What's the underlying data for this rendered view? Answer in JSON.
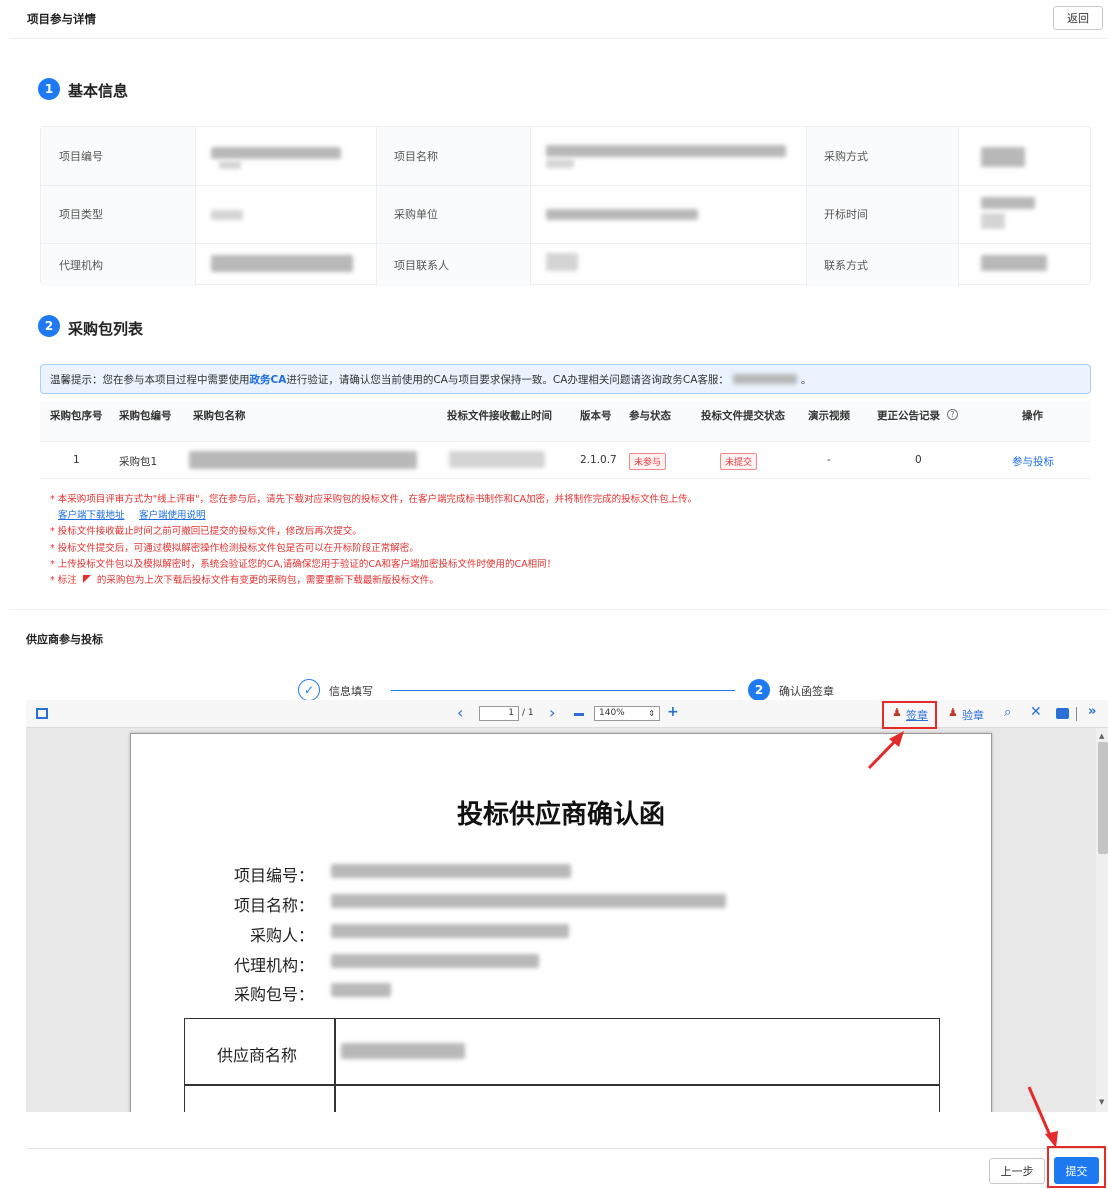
{
  "header": {
    "title": "项目参与详情",
    "back_label": "返回"
  },
  "section1": {
    "num": "1",
    "title": "基本信息"
  },
  "basic_info": {
    "project_no_label": "项目编号",
    "project_name_label": "项目名称",
    "purchase_method_label": "采购方式",
    "project_type_label": "项目类型",
    "purchase_unit_label": "采购单位",
    "open_time_label": "开标时间",
    "agency_label": "代理机构",
    "contact_label": "项目联系人",
    "contact_method_label": "联系方式"
  },
  "section2": {
    "num": "2",
    "title": "采购包列表"
  },
  "tip": {
    "prefix": "温馨提示：您在参与本项目过程中需要使用",
    "link": "政务CA",
    "suffix": "进行验证，请确认您当前使用的CA与项目要求保持一致。CA办理相关问题请咨询政务CA客服：",
    "end": "。"
  },
  "package_table": {
    "headers": [
      "采购包序号",
      "采购包编号",
      "采购包名称",
      "投标文件接收截止时间",
      "版本号",
      "参与状态",
      "投标文件提交状态",
      "演示视频",
      "更正公告记录",
      "操作"
    ],
    "help_icon": "question-circle-icon",
    "rows": [
      {
        "seq": "1",
        "code": "采购包1",
        "version": "2.1.0.7",
        "participate_status": "未参与",
        "submit_status": "未提交",
        "video": "-",
        "correction_count": "0",
        "action": "参与投标"
      }
    ]
  },
  "notes": {
    "n1": "* 本采购项目评审方式为\"线上评审\"，您在参与后，请先下载对应采购包的投标文件，在客户端完成标书制作和CA加密，并将制作完成的投标文件包上传。",
    "client_download": "客户端下载地址",
    "client_manual": "客户端使用说明",
    "n2": "* 投标文件接收截止时间之前可撤回已提交的投标文件，修改后再次提交。",
    "n3": "* 投标文件提交后，可通过模拟解密操作检测投标文件包是否可以在开标阶段正常解密。",
    "n4": "* 上传投标文件包以及模拟解密时，系统会验证您的CA,请确保您用于验证的CA和客户端加密投标文件时使用的CA相同！",
    "n5_prefix": "* 标注",
    "n5_suffix": "的采购包为上次下载后投标文件有变更的采购包，需要重新下载最新版投标文件。"
  },
  "supplier": {
    "title": "供应商参与投标",
    "step1_label": "信息填写",
    "step2_num": "2",
    "step2_label": "确认函签章"
  },
  "viewer": {
    "page_current": "1",
    "page_total": "/ 1",
    "zoom": "140%",
    "sign_label": "签章",
    "verify_label": "验章"
  },
  "document": {
    "title": "投标供应商确认函",
    "project_no_label": "项目编号：",
    "project_name_label": "项目名称：",
    "purchaser_label": "采购人：",
    "agency_label": "代理机构：",
    "package_no_label": "采购包号：",
    "supplier_name_label": "供应商名称"
  },
  "footer": {
    "prev_label": "上一步",
    "submit_label": "提交"
  },
  "colors": {
    "primary": "#1e7af2",
    "danger": "#e5302f",
    "highlight_box": "#e52a2a"
  }
}
